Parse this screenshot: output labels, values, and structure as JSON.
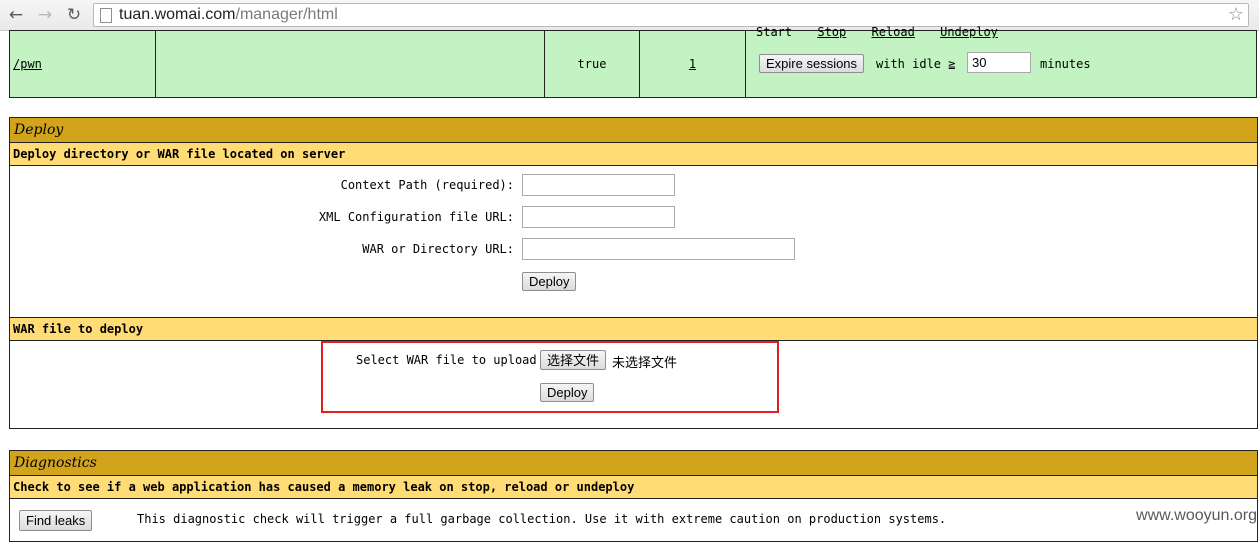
{
  "browser": {
    "back_icon": "←",
    "forward_icon": "→",
    "reload_icon": "↻",
    "url_host": "tuan.womai.com",
    "url_path": "/manager/html",
    "star_icon": "☆"
  },
  "app_row": {
    "path": "/pwn",
    "display_name": "",
    "running": "true",
    "sessions": "1",
    "commands": [
      "Start",
      "Stop",
      "Reload",
      "Undeploy"
    ],
    "expire_button": "Expire sessions",
    "with_idle_label": "with idle ≧",
    "idle_value": "30",
    "minutes_label": "minutes"
  },
  "deploy": {
    "title": "Deploy",
    "server_header": "Deploy directory or WAR file located on server",
    "context_path_label": "Context Path (required):",
    "xml_config_label": "XML Configuration file URL:",
    "war_dir_label": "WAR or Directory URL:",
    "deploy_button": "Deploy",
    "war_header": "WAR file to deploy",
    "select_war_label": "Select WAR file to upload",
    "choose_file_button": "选择文件",
    "no_file_text": "未选择文件",
    "upload_deploy_button": "Deploy"
  },
  "diagnostics": {
    "title": "Diagnostics",
    "header": "Check to see if a web application has caused a memory leak on stop, reload or undeploy",
    "find_leaks_button": "Find leaks",
    "description": "This diagnostic check will trigger a full garbage collection. Use it with extreme caution on production systems."
  },
  "watermark": "www.wooyun.org",
  "colors": {
    "app_row_bg": "#c3f3c3",
    "title_bg": "#d2a41c",
    "header_bg": "#ffdc75",
    "highlight_box": "#e02020"
  }
}
